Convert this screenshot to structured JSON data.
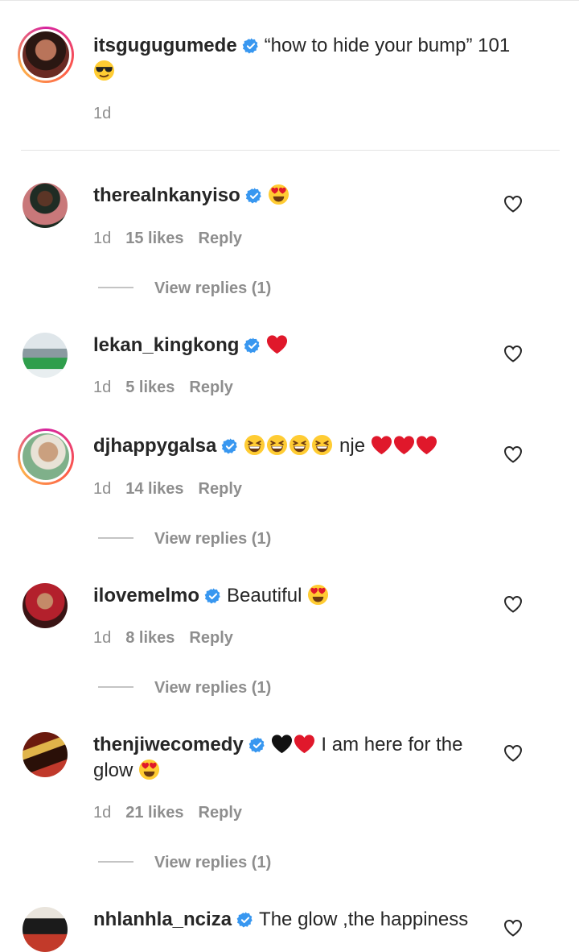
{
  "caption": {
    "username": "itsgugugumede",
    "text": "“how to hide your bump” 101",
    "time": "1d"
  },
  "comments": [
    {
      "username": "therealnkanyiso",
      "text": "",
      "time": "1d",
      "likes": "15 likes",
      "reply": "Reply",
      "view_replies": "View replies (1)"
    },
    {
      "username": "lekan_kingkong",
      "text": "",
      "time": "1d",
      "likes": "5 likes",
      "reply": "Reply"
    },
    {
      "username": "djhappygalsa",
      "text": "nje",
      "time": "1d",
      "likes": "14 likes",
      "reply": "Reply",
      "view_replies": "View replies (1)"
    },
    {
      "username": "ilovemelmo",
      "text": "Beautiful",
      "time": "1d",
      "likes": "8 likes",
      "reply": "Reply",
      "view_replies": "View replies (1)"
    },
    {
      "username": "thenjiwecomedy",
      "text": "I am here for the",
      "text_line2": "glow",
      "time": "1d",
      "likes": "21 likes",
      "reply": "Reply",
      "view_replies": "View replies (1)"
    },
    {
      "username": "nhlanhla_nciza",
      "text": "The glow ,the happiness"
    }
  ],
  "icons": {
    "verified": "verified-badge-icon",
    "like": "heart-outline-icon"
  },
  "colors": {
    "verified": "#3897f0",
    "muted": "#8e8e8e",
    "text": "#262626",
    "heart_red": "#e0182b"
  }
}
